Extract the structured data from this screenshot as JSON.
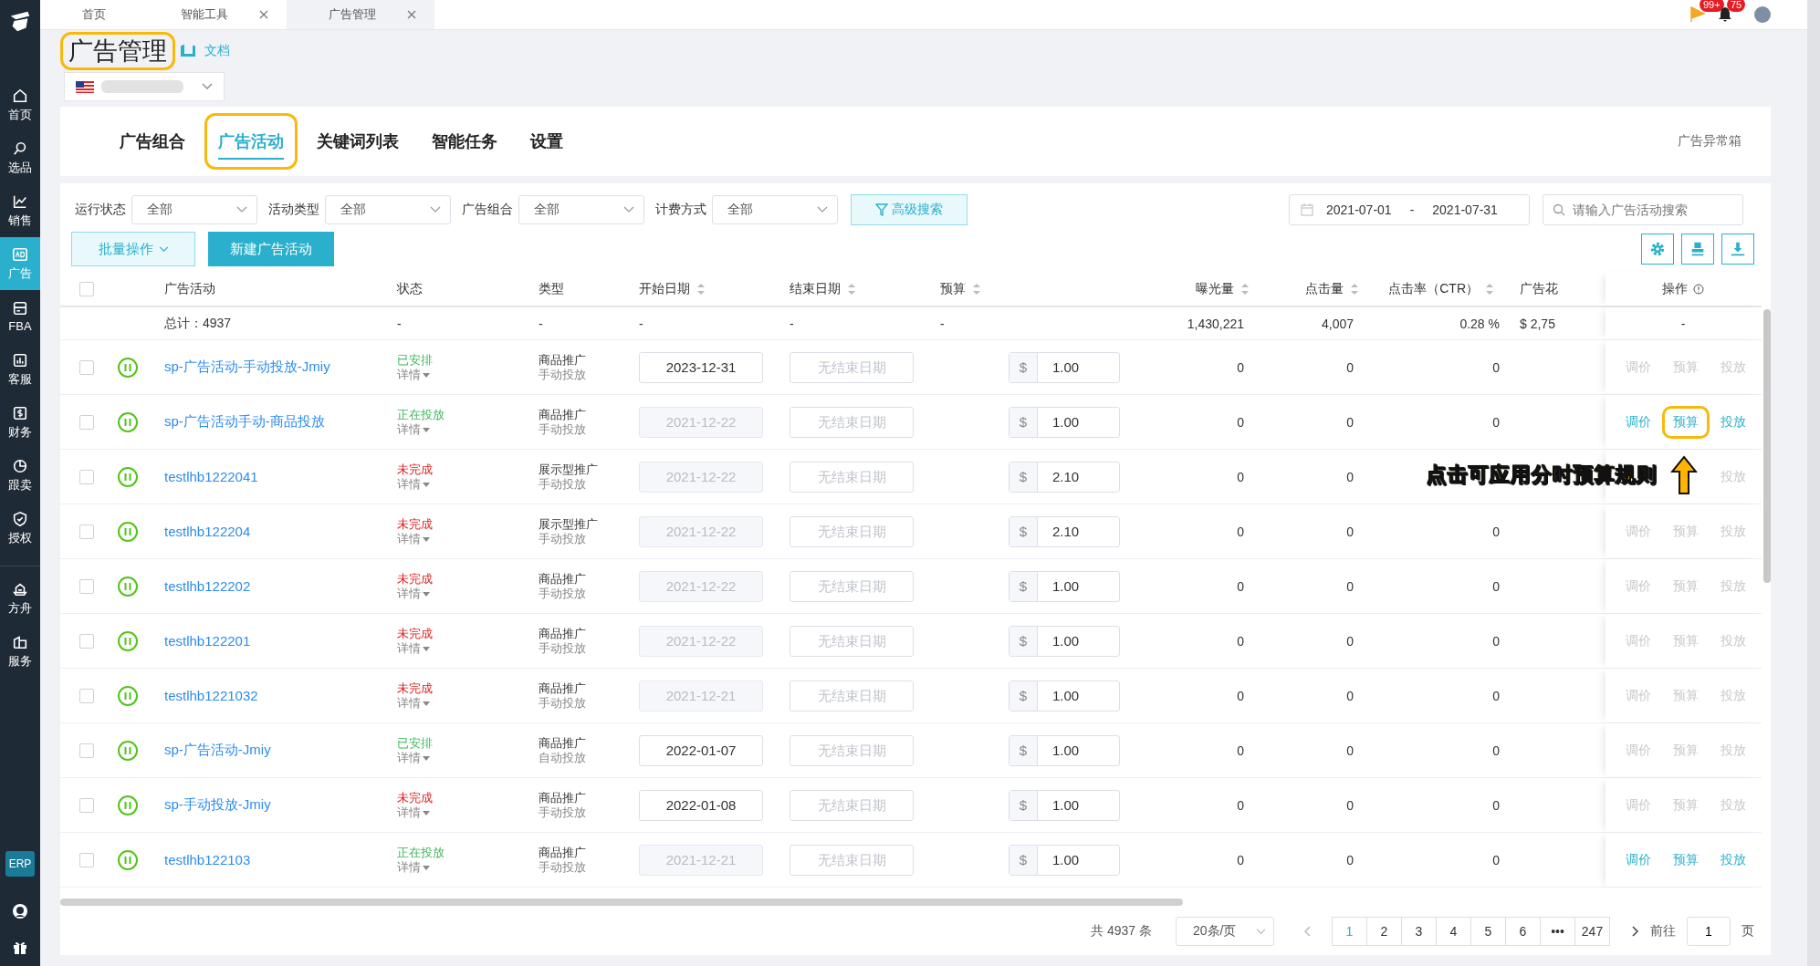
{
  "sidebar": {
    "items": [
      {
        "label": "首页",
        "kind": "home",
        "selected": false
      },
      {
        "label": "选品",
        "kind": "search",
        "selected": false
      },
      {
        "label": "销售",
        "kind": "trend",
        "selected": false
      },
      {
        "label": "广告",
        "kind": "ad",
        "selected": true
      },
      {
        "label": "FBA",
        "kind": "box",
        "selected": false
      },
      {
        "label": "客服",
        "kind": "bars",
        "selected": false
      },
      {
        "label": "财务",
        "kind": "dollar",
        "selected": false
      },
      {
        "label": "跟卖",
        "kind": "pie",
        "selected": false
      },
      {
        "label": "授权",
        "kind": "shield",
        "selected": false
      },
      {
        "label": "方舟",
        "kind": "ark",
        "selected": false
      },
      {
        "label": "服务",
        "kind": "building",
        "selected": false
      }
    ],
    "badge": "ERP"
  },
  "open_tabs": [
    {
      "label": "首页",
      "closable": false,
      "selected": false
    },
    {
      "label": "智能工具",
      "closable": true,
      "selected": false
    },
    {
      "label": "广告管理",
      "closable": true,
      "selected": true
    }
  ],
  "notifications": {
    "flag_count": "99+",
    "bell_count": "75"
  },
  "page": {
    "title": "广告管理",
    "title_highlighted": true,
    "doc_link": "文档"
  },
  "tabs": [
    {
      "label": "广告组合",
      "selected": false,
      "highlighted": false
    },
    {
      "label": "广告活动",
      "selected": true,
      "highlighted": true
    },
    {
      "label": "关键词列表",
      "selected": false,
      "highlighted": false
    },
    {
      "label": "智能任务",
      "selected": false,
      "highlighted": false
    },
    {
      "label": "设置",
      "selected": false,
      "highlighted": false
    }
  ],
  "anomaly_box": "广告异常箱",
  "filters": [
    {
      "label": "运行状态",
      "value": "全部"
    },
    {
      "label": "活动类型",
      "value": "全部"
    },
    {
      "label": "广告组合",
      "value": "全部"
    },
    {
      "label": "计费方式",
      "value": "全部"
    }
  ],
  "advanced_search": "高级搜索",
  "date_range": {
    "start": "2021-07-01",
    "separator": "-",
    "end": "2021-07-31"
  },
  "search": {
    "placeholder": "请输入广告活动搜索"
  },
  "batch_button": "批量操作",
  "new_button": "新建广告活动",
  "table": {
    "select_all_checked": false,
    "columns": [
      {
        "label": "广告活动",
        "sortable": false
      },
      {
        "label": "状态",
        "sortable": false
      },
      {
        "label": "类型",
        "sortable": false
      },
      {
        "label": "开始日期",
        "sortable": true
      },
      {
        "label": "结束日期",
        "sortable": true
      },
      {
        "label": "预算",
        "sortable": true
      },
      {
        "label": "曝光量",
        "sortable": true
      },
      {
        "label": "点击量",
        "sortable": true
      },
      {
        "label": "点击率（CTR）",
        "sortable": true
      },
      {
        "label": "广告花",
        "sortable": false
      },
      {
        "label": "操作",
        "sortable": false
      }
    ],
    "total": {
      "label": "总计：4937",
      "status": "-",
      "type": "-",
      "start": "-",
      "end": "-",
      "budget": "-",
      "impressions": "1,430,221",
      "clicks": "4,007",
      "ctr": "0.28 %",
      "spend": "$ 2,75",
      "actions": "-"
    },
    "rows": [
      {
        "checked": false,
        "name": "sp-广告活动-手动投放-Jmiy",
        "status": "已安排",
        "status_error": false,
        "detail": "详情",
        "type": "商品推广",
        "targeting": "手动投放",
        "start": "2023-12-31",
        "start_disabled": false,
        "end_placeholder": "无结束日期",
        "currency": "$",
        "budget": "1.00",
        "impressions": "0",
        "clicks": "0",
        "ctr": "0",
        "actions": [
          {
            "label": "调价",
            "enabled": false,
            "highlighted": false
          },
          {
            "label": "预算",
            "enabled": false,
            "highlighted": false
          },
          {
            "label": "投放",
            "enabled": false,
            "highlighted": false
          }
        ]
      },
      {
        "checked": false,
        "name": "sp-广告活动手动-商品投放",
        "status": "正在投放",
        "status_error": false,
        "detail": "详情",
        "type": "商品推广",
        "targeting": "手动投放",
        "start": "2021-12-22",
        "start_disabled": true,
        "end_placeholder": "无结束日期",
        "currency": "$",
        "budget": "1.00",
        "impressions": "0",
        "clicks": "0",
        "ctr": "0",
        "actions": [
          {
            "label": "调价",
            "enabled": true,
            "highlighted": false
          },
          {
            "label": "预算",
            "enabled": true,
            "highlighted": true
          },
          {
            "label": "投放",
            "enabled": true,
            "highlighted": false
          }
        ]
      },
      {
        "checked": false,
        "name": "testlhb1222041",
        "status": "未完成",
        "status_error": true,
        "detail": "详情",
        "type": "展示型推广",
        "targeting": "手动投放",
        "start": "2021-12-22",
        "start_disabled": true,
        "end_placeholder": "无结束日期",
        "currency": "$",
        "budget": "2.10",
        "impressions": "0",
        "clicks": "0",
        "callout": "点击可应用分时预算规则",
        "actions": [
          {
            "label": "投放",
            "enabled": false,
            "highlighted": false
          }
        ]
      },
      {
        "checked": false,
        "name": "testlhb122204",
        "status": "未完成",
        "status_error": true,
        "detail": "详情",
        "type": "展示型推广",
        "targeting": "手动投放",
        "start": "2021-12-22",
        "start_disabled": true,
        "end_placeholder": "无结束日期",
        "currency": "$",
        "budget": "2.10",
        "impressions": "0",
        "clicks": "0",
        "ctr": "0",
        "actions": [
          {
            "label": "调价",
            "enabled": false,
            "highlighted": false
          },
          {
            "label": "预算",
            "enabled": false,
            "highlighted": false
          },
          {
            "label": "投放",
            "enabled": false,
            "highlighted": false
          }
        ]
      },
      {
        "checked": false,
        "name": "testlhb122202",
        "status": "未完成",
        "status_error": true,
        "detail": "详情",
        "type": "商品推广",
        "targeting": "手动投放",
        "start": "2021-12-22",
        "start_disabled": true,
        "end_placeholder": "无结束日期",
        "currency": "$",
        "budget": "1.00",
        "impressions": "0",
        "clicks": "0",
        "ctr": "0",
        "actions": [
          {
            "label": "调价",
            "enabled": false,
            "highlighted": false
          },
          {
            "label": "预算",
            "enabled": false,
            "highlighted": false
          },
          {
            "label": "投放",
            "enabled": false,
            "highlighted": false
          }
        ]
      },
      {
        "checked": false,
        "name": "testlhb122201",
        "status": "未完成",
        "status_error": true,
        "detail": "详情",
        "type": "商品推广",
        "targeting": "手动投放",
        "start": "2021-12-22",
        "start_disabled": true,
        "end_placeholder": "无结束日期",
        "currency": "$",
        "budget": "1.00",
        "impressions": "0",
        "clicks": "0",
        "ctr": "0",
        "actions": [
          {
            "label": "调价",
            "enabled": false,
            "highlighted": false
          },
          {
            "label": "预算",
            "enabled": false,
            "highlighted": false
          },
          {
            "label": "投放",
            "enabled": false,
            "highlighted": false
          }
        ]
      },
      {
        "checked": false,
        "name": "testlhb1221032",
        "status": "未完成",
        "status_error": true,
        "detail": "详情",
        "type": "商品推广",
        "targeting": "手动投放",
        "start": "2021-12-21",
        "start_disabled": true,
        "end_placeholder": "无结束日期",
        "currency": "$",
        "budget": "1.00",
        "impressions": "0",
        "clicks": "0",
        "ctr": "0",
        "actions": [
          {
            "label": "调价",
            "enabled": false,
            "highlighted": false
          },
          {
            "label": "预算",
            "enabled": false,
            "highlighted": false
          },
          {
            "label": "投放",
            "enabled": false,
            "highlighted": false
          }
        ]
      },
      {
        "checked": false,
        "name": "sp-广告活动-Jmiy",
        "status": "已安排",
        "status_error": false,
        "detail": "详情",
        "type": "商品推广",
        "targeting": "自动投放",
        "start": "2022-01-07",
        "start_disabled": false,
        "end_placeholder": "无结束日期",
        "currency": "$",
        "budget": "1.00",
        "impressions": "0",
        "clicks": "0",
        "ctr": "0",
        "actions": [
          {
            "label": "调价",
            "enabled": false,
            "highlighted": false
          },
          {
            "label": "预算",
            "enabled": false,
            "highlighted": false
          },
          {
            "label": "投放",
            "enabled": false,
            "highlighted": false
          }
        ]
      },
      {
        "checked": false,
        "name": "sp-手动投放-Jmiy",
        "status": "未完成",
        "status_error": true,
        "detail": "详情",
        "type": "商品推广",
        "targeting": "手动投放",
        "start": "2022-01-08",
        "start_disabled": false,
        "end_placeholder": "无结束日期",
        "currency": "$",
        "budget": "1.00",
        "impressions": "0",
        "clicks": "0",
        "ctr": "0",
        "actions": [
          {
            "label": "调价",
            "enabled": false,
            "highlighted": false
          },
          {
            "label": "预算",
            "enabled": false,
            "highlighted": false
          },
          {
            "label": "投放",
            "enabled": false,
            "highlighted": false
          }
        ]
      },
      {
        "checked": false,
        "name": "testlhb122103",
        "status": "正在投放",
        "status_error": false,
        "detail": "详情",
        "type": "商品推广",
        "targeting": "手动投放",
        "start": "2021-12-21",
        "start_disabled": true,
        "end_placeholder": "无结束日期",
        "currency": "$",
        "budget": "1.00",
        "impressions": "0",
        "clicks": "0",
        "ctr": "0",
        "actions": [
          {
            "label": "调价",
            "enabled": true,
            "highlighted": false
          },
          {
            "label": "预算",
            "enabled": true,
            "highlighted": false
          },
          {
            "label": "投放",
            "enabled": true,
            "highlighted": false
          }
        ]
      }
    ]
  },
  "pagination": {
    "total": "共 4937 条",
    "page_size": "20条/页",
    "pages": [
      {
        "label": "1",
        "selected": true
      },
      {
        "label": "2",
        "selected": false
      },
      {
        "label": "3",
        "selected": false
      },
      {
        "label": "4",
        "selected": false
      },
      {
        "label": "5",
        "selected": false
      },
      {
        "label": "6",
        "selected": false
      },
      {
        "label": "•••",
        "selected": false
      },
      {
        "label": "247",
        "selected": false
      }
    ],
    "goto_label": "前往",
    "goto_value": "1",
    "page_unit": "页"
  }
}
